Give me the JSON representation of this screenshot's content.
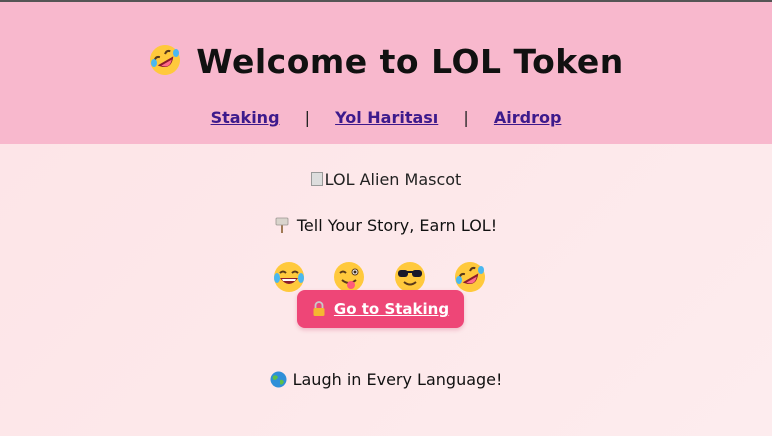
{
  "header": {
    "title": "Welcome to LOL Token",
    "title_icon": "rolling-on-floor-laughing-emoji",
    "nav": {
      "staking": "Staking",
      "roadmap": "Yol Haritası",
      "airdrop": "Airdrop",
      "separator": "|"
    }
  },
  "main": {
    "mascot_alt": "LOL Alien Mascot",
    "story_text": "Tell Your Story, Earn LOL!",
    "story_icon": "signpost-icon",
    "emojis": [
      "tears-of-joy-emoji",
      "winking-tongue-emoji",
      "sunglasses-emoji",
      "rolling-on-floor-laughing-emoji"
    ],
    "staking_button": "Go to Staking",
    "staking_button_icon": "lock-icon",
    "laugh_text": "Laugh in Every Language!",
    "laugh_icon": "globe-icon"
  },
  "colors": {
    "header_bg": "#f8b8cd",
    "page_bg": "#fde6e9",
    "button_bg": "#ee4677",
    "nav_link": "#3d1a8c"
  }
}
